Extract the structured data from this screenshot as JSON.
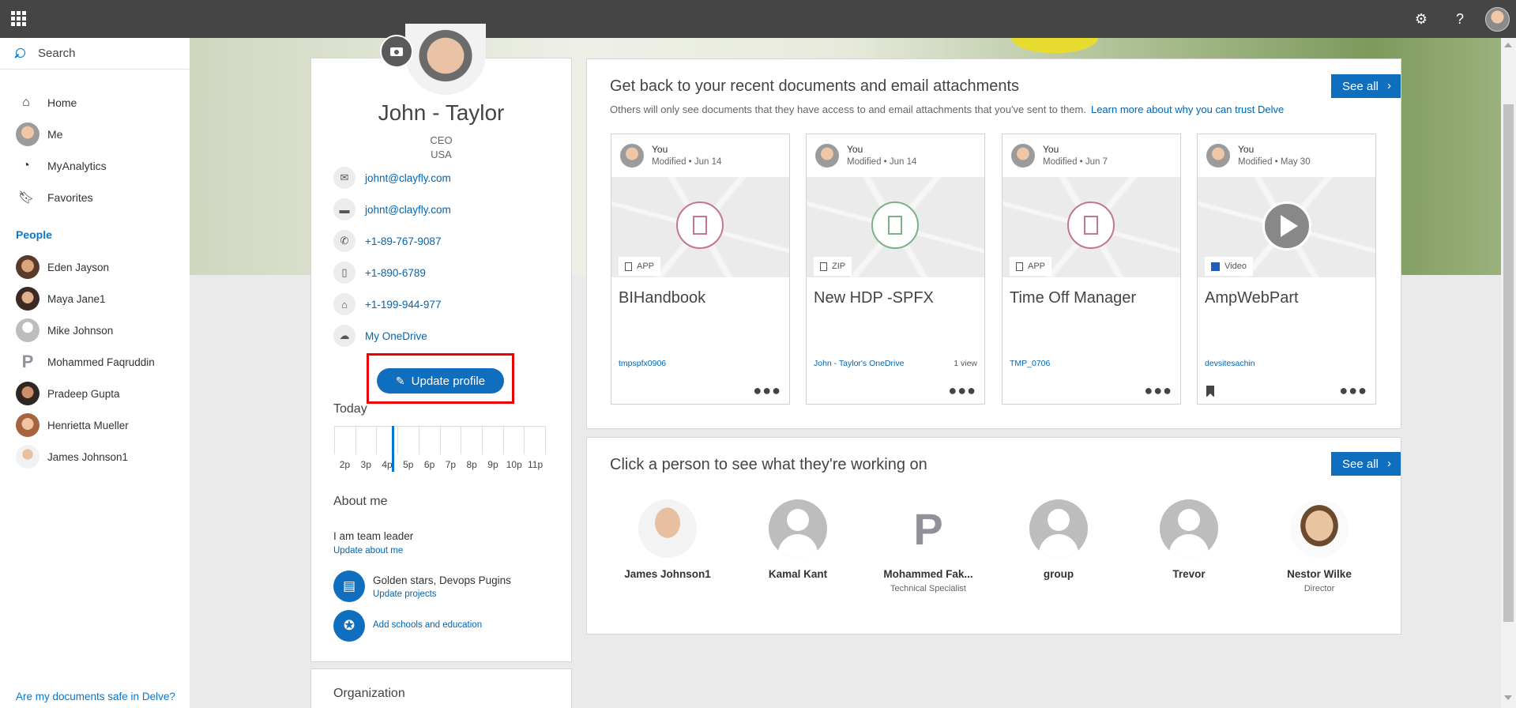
{
  "topbar": {
    "settings_icon": "gear-icon",
    "help_label": "?",
    "avatar_icon": "user-avatar"
  },
  "leftnav": {
    "search_placeholder": "Search",
    "items": [
      {
        "label": "Home",
        "icon": "home-icon"
      },
      {
        "label": "Me",
        "icon": "avatar"
      },
      {
        "label": "MyAnalytics",
        "icon": "analytics-icon"
      },
      {
        "label": "Favorites",
        "icon": "bookmark-icon"
      }
    ],
    "people_heading": "People",
    "people": [
      {
        "name": "Eden Jayson"
      },
      {
        "name": "Maya Jane1"
      },
      {
        "name": "Mike Johnson"
      },
      {
        "name": "Mohammed Faqruddin"
      },
      {
        "name": "Pradeep Gupta"
      },
      {
        "name": "Henrietta Mueller"
      },
      {
        "name": "James Johnson1"
      }
    ],
    "safe_link": "Are my documents safe in Delve?"
  },
  "profile": {
    "name": "John - Taylor",
    "title": "CEO",
    "country": "USA",
    "contacts": [
      {
        "icon": "mail-icon",
        "value": "johnt@clayfly.com"
      },
      {
        "icon": "chat-icon",
        "value": "johnt@clayfly.com"
      },
      {
        "icon": "phone-icon",
        "value": "+1-89-767-9087"
      },
      {
        "icon": "mobile-icon",
        "value": "+1-890-6789"
      },
      {
        "icon": "home-phone-icon",
        "value": "+1-199-944-977"
      },
      {
        "icon": "cloud-icon",
        "value": "My OneDrive"
      }
    ],
    "update_button": "Update profile",
    "today_label": "Today",
    "timeline_hours": [
      "2p",
      "3p",
      "4p",
      "5p",
      "6p",
      "7p",
      "8p",
      "9p",
      "10p",
      "11p"
    ],
    "about_heading": "About me",
    "about_text": "I am team leader",
    "about_link": "Update about me",
    "projects_text": "Golden stars, Devops Pugins",
    "projects_link": "Update projects",
    "education_link": "Add schools and education",
    "org_label": "Organization"
  },
  "documents": {
    "title": "Get back to your recent documents and email attachments",
    "subtitle": "Others will only see documents that they have access to and email attachments that you've sent to them.",
    "subtitle_link": "Learn more about why you can trust Delve",
    "see_all": "See all",
    "cards": [
      {
        "author": "You",
        "modified": "Modified • Jun 14",
        "type": "APP",
        "title": "BIHandbook",
        "site": "tmpspfx0906",
        "views": "",
        "icon_color": "#c4768c"
      },
      {
        "author": "You",
        "modified": "Modified • Jun 14",
        "type": "ZIP",
        "title": "New HDP -SPFX",
        "site": "John - Taylor's OneDrive",
        "views": "1 view",
        "icon_color": "#7db08a"
      },
      {
        "author": "You",
        "modified": "Modified • Jun 7",
        "type": "APP",
        "title": "Time Off Manager",
        "site": "TMP_0706",
        "views": "",
        "icon_color": "#c4768c"
      },
      {
        "author": "You",
        "modified": "Modified • May 30",
        "type": "Video",
        "title": "AmpWebPart",
        "site": "devsitesachin",
        "views": "",
        "icon_color": "#888888"
      }
    ]
  },
  "people_panel": {
    "title": "Click a person to see what they're working on",
    "see_all": "See all",
    "people": [
      {
        "name": "James Johnson1",
        "role": ""
      },
      {
        "name": "Kamal Kant",
        "role": ""
      },
      {
        "name": "Mohammed Fak...",
        "role": "Technical Specialist"
      },
      {
        "name": "group",
        "role": ""
      },
      {
        "name": "Trevor",
        "role": ""
      },
      {
        "name": "Nestor Wilke",
        "role": "Director"
      }
    ]
  },
  "colors": {
    "accent": "#106ebe",
    "topbar": "#454545",
    "link": "#0065b3",
    "highlight_outline": "#e00000"
  }
}
